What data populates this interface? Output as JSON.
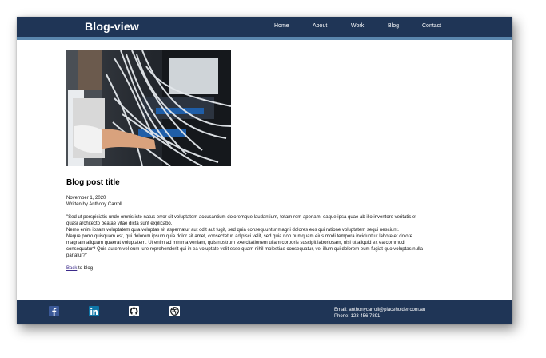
{
  "header": {
    "logo": "Blog-view",
    "nav": [
      "Home",
      "About",
      "Work",
      "Blog",
      "Contact"
    ]
  },
  "post": {
    "title": "Blog post title",
    "date": "November 1, 2020",
    "author": "Written by Anthony Carroll",
    "body_lines": [
      "\"Sed ut perspiciatis unde omnis iste natus error sit voluptatem accusantium doloremque laudantium, totam rem aperiam, eaque ipsa quae ab illo inventore veritatis et",
      "quasi architecto beatae vitae dicta sunt explicabo.",
      "Nemo enim ipsam voluptatem quia voluptas sit aspernatur aut odit aut fugit, sed quia consequuntur magni dolores eos qui ratione voluptatem sequi nesciunt.",
      "Neque porro quisquam est, qui dolorem ipsum quia dolor sit amet, consectetur, adipisci velit, sed quia non numquam eius modi tempora incidunt ut labore et dolore",
      "magnam aliquam quaerat voluptatem. Ut enim ad minima veniam, quis nostrum exercitationem ullam corporis suscipit laboriosam, nisi ut aliquid ex ea commodi",
      "consequatur? Quis autem vel eum iure reprehenderit qui in ea voluptate velit esse quam nihil molestiae consequatur, vel illum qui dolorem eum fugiat quo voluptas nulla",
      "pariatur?\""
    ],
    "back_link": "Back",
    "back_suffix": " to blog",
    "image_icon": "server-cabling-photo"
  },
  "footer": {
    "social": [
      "facebook-icon",
      "linkedin-icon",
      "github-icon",
      "dribbble-icon"
    ],
    "email": "Email: anthonycarroll@placeholder.com.au",
    "phone": "Phone: 123 456 7891"
  },
  "colors": {
    "header_bg": "#1f3556",
    "header_stripe": "#5a86ad",
    "link": "#3b2a8a"
  }
}
